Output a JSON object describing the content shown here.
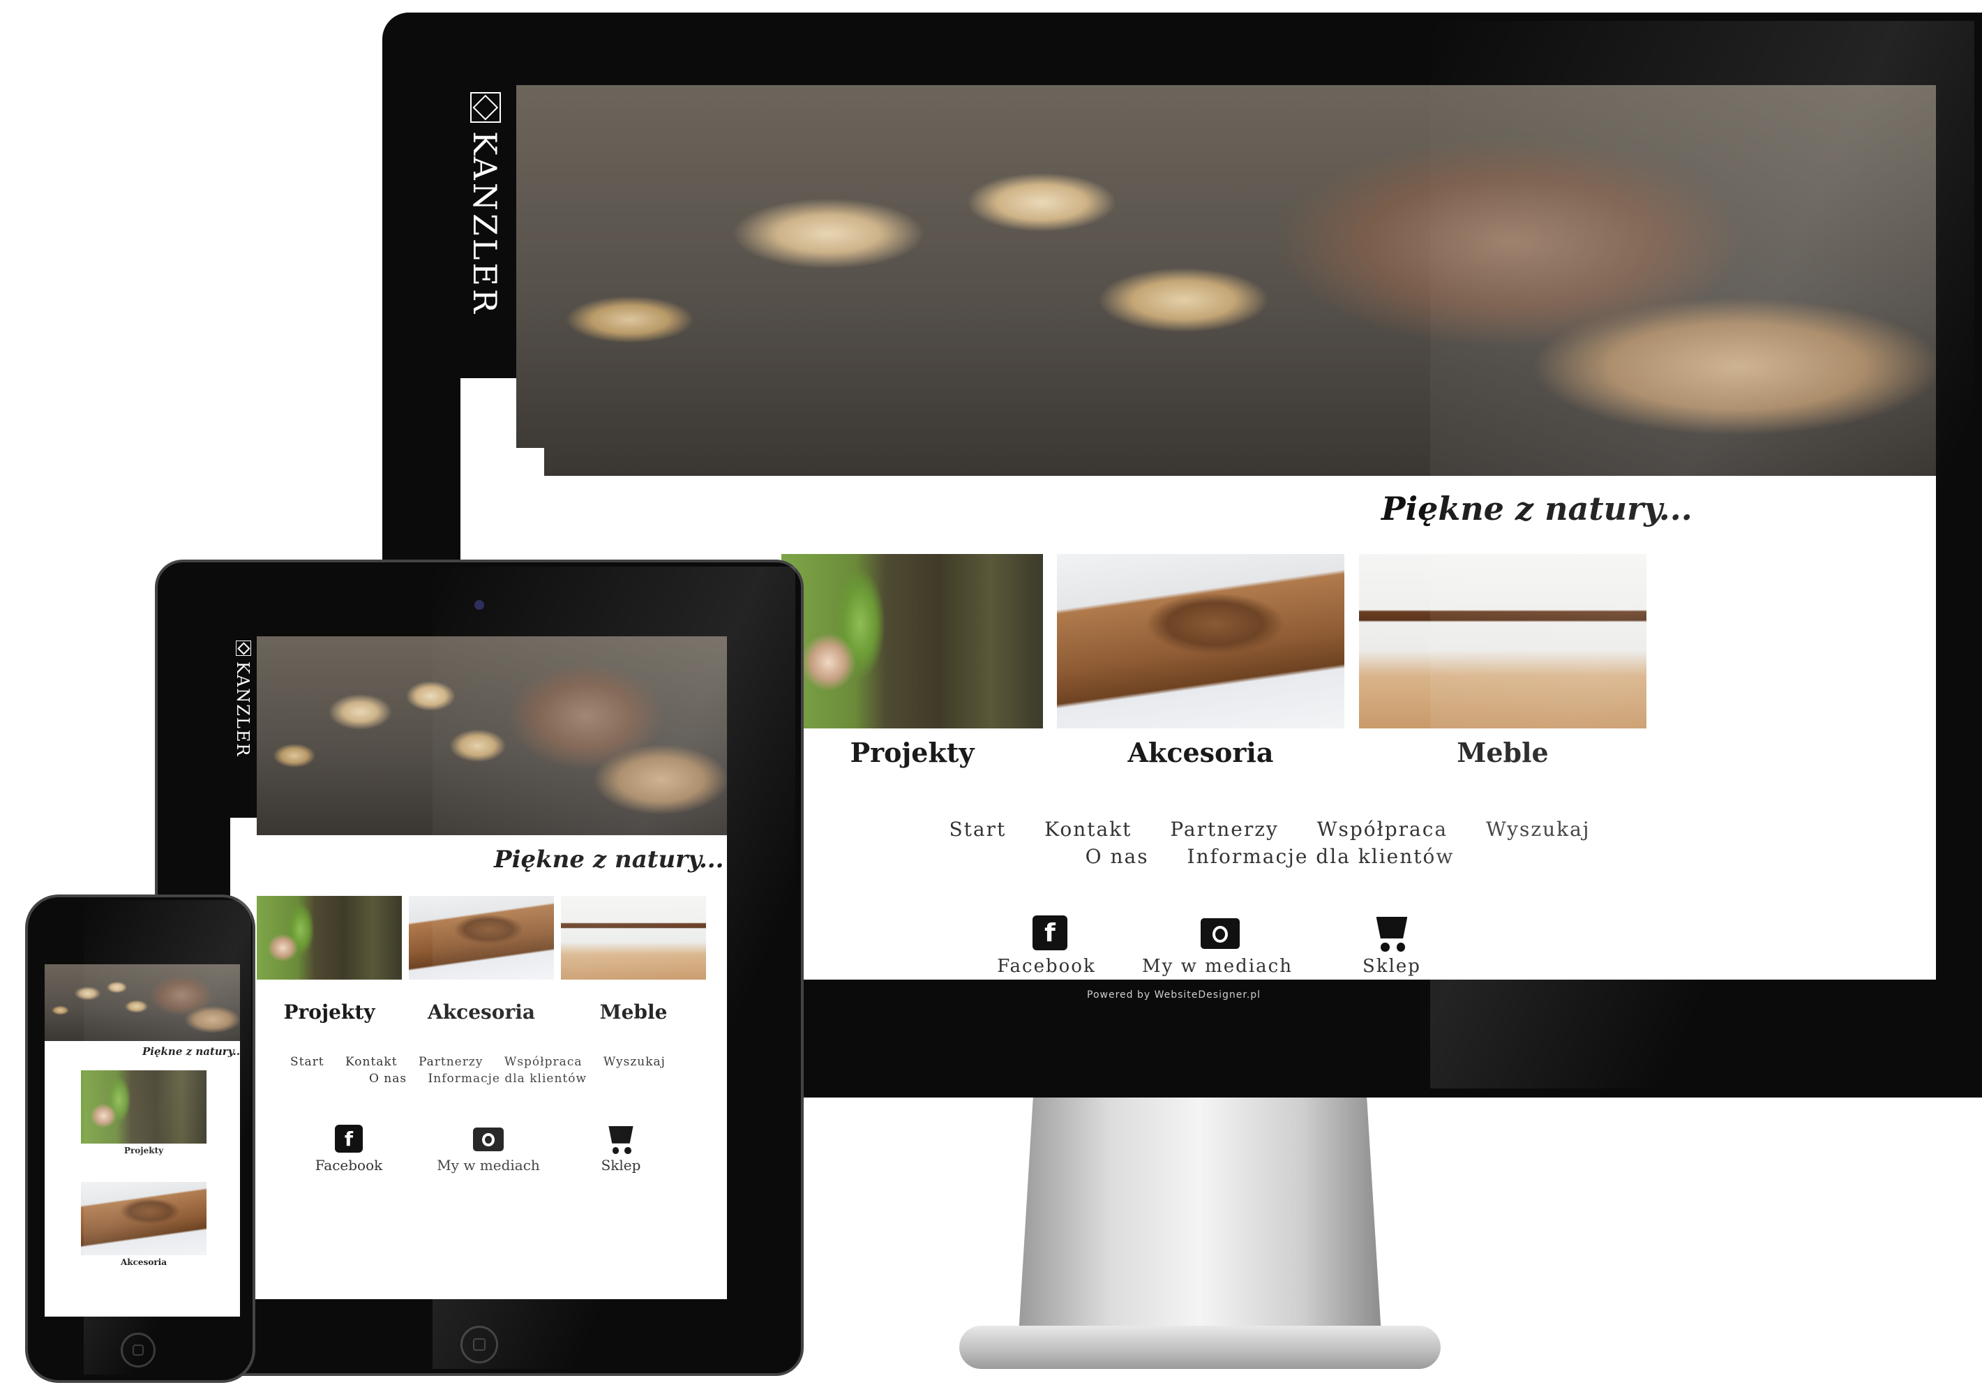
{
  "brand": {
    "name": "KANZLER"
  },
  "tagline": "Piękne z natury...",
  "categories": [
    {
      "label": "Projekty",
      "icon": "tree-child-photo"
    },
    {
      "label": "Akcesoria",
      "icon": "wooden-accessory-photo"
    },
    {
      "label": "Meble",
      "icon": "dining-table-photo"
    }
  ],
  "nav": {
    "row1": [
      "Start",
      "Kontakt",
      "Partnerzy",
      "Współpraca",
      "Wyszukaj"
    ],
    "row2": [
      "O nas",
      "Informacje dla klientów"
    ]
  },
  "social": [
    {
      "label": "Facebook",
      "icon": "facebook-icon"
    },
    {
      "label": "My w mediach",
      "icon": "camera-icon"
    },
    {
      "label": "Sklep",
      "icon": "cart-icon"
    }
  ],
  "footer": {
    "powered": "Powered by WebsiteDesigner.pl"
  },
  "phone": {
    "tagline": "Piękne z natury...",
    "tiles": [
      "Projekty",
      "Akcesoria"
    ]
  },
  "colors": {
    "bezel": "#0b0b0b",
    "screen": "#ffffff",
    "text": "#1a1a1a"
  }
}
